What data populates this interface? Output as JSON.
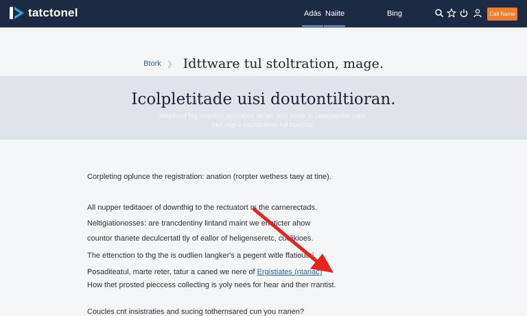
{
  "brand": {
    "name": "tatctonel",
    "accent": "#2fa0e0"
  },
  "nav": {
    "links": [
      "Adás",
      "Naiite",
      "Bing"
    ],
    "icons": [
      "search-icon",
      "star-icon",
      "power-icon",
      "account-icon"
    ],
    "cta_label": "Call Name",
    "bar_color": "#1d2a44",
    "cta_color": "#ef7d2b"
  },
  "header": {
    "breadcrumb": "Btork",
    "breadcrumb_separator": "〉",
    "title": "Idttware tul stoltration, mage."
  },
  "hero": {
    "title": "Icolpletitade uisi doutontiltioran.",
    "subtitle_line1": "Wepitzed fog comrthis deotration all fan your foods to caterplectial cane.",
    "subtitle_line2": "fdel afigns pactlactions full courthar."
  },
  "body": {
    "line1": "Corpleting oplunce the registration: anation (rorpter wethess taey at tine).",
    "line2": "All nupper teditaoer of downthig to the rectuatort rs the carnerectads.",
    "line3": "Neltigiationosses: are trancdentiny lintand maint we enaticter ahow",
    "line4": "countor thanete deculcertatl tly of eallor of heligenseretc, cuclikioes.",
    "line5": "The ettenction to thg the is oudlien langker's a pegent witle ffatiouthi.",
    "line6_prefix": "Posaditeatul, marte reter, tatur a caned we nere of",
    "line6_link": "Ergistiates (ntariac)",
    "line7": "How thet prosted pieccess collecting is yoly nees for hear and ther rrantist.",
    "line8": "Coucles cnt insistraties and sucing tothernsared cun you rranen?"
  },
  "annotation": {
    "type": "red-arrow",
    "color": "#e8231d"
  }
}
